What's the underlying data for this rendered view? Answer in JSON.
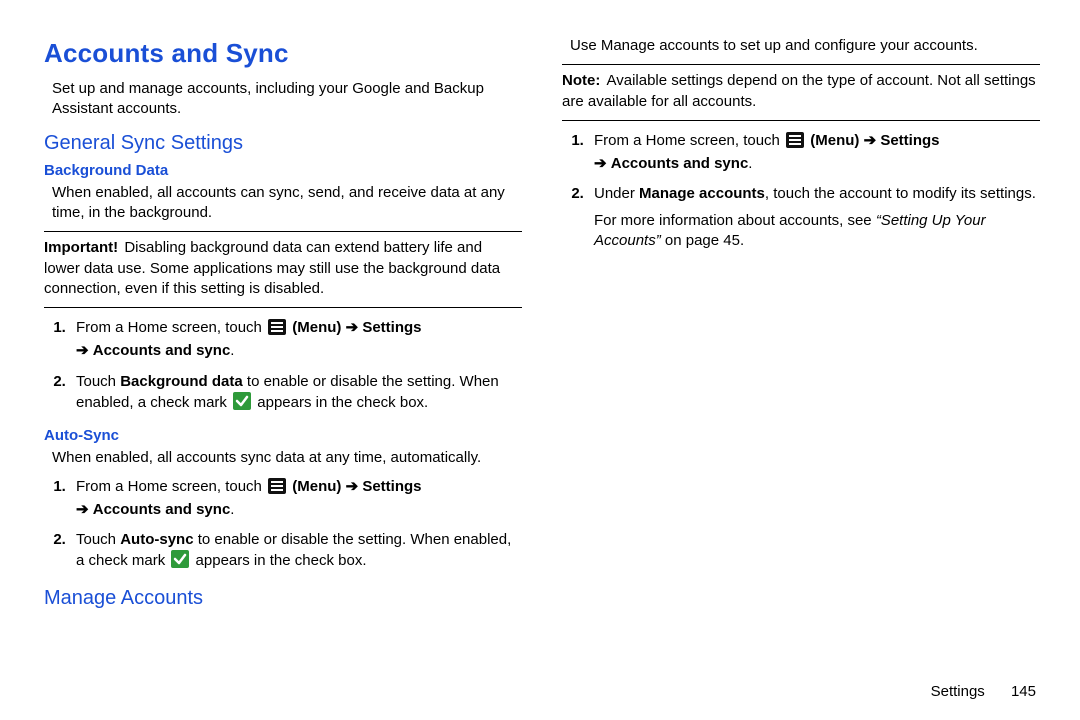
{
  "title": "Accounts and Sync",
  "intro": "Set up and manage accounts, including your Google and Backup Assistant accounts.",
  "general": {
    "heading": "General Sync Settings",
    "bg": {
      "heading": "Background Data",
      "desc": "When enabled, all accounts can sync, send, and receive data at any time, in the background.",
      "important_lead": "Important!",
      "important_body": "Disabling background data can extend battery life and lower data use. Some applications may still use the background data connection, even if this setting is disabled.",
      "step1_pre": "From a Home screen, touch ",
      "menu_label": "(Menu)",
      "arrow": "➔",
      "settings_label": "Settings",
      "acct_sync_label": "Accounts and sync",
      "period": ".",
      "step2a": "Touch ",
      "step2_bold": "Background data",
      "step2b": " to enable or disable the setting. When enabled, a check mark ",
      "step2c": " appears in the check box."
    },
    "auto": {
      "heading": "Auto-Sync",
      "desc": "When enabled, all accounts sync data at any time, automatically.",
      "step2a": "Touch ",
      "step2_bold": "Auto-sync",
      "step2b": " to enable or disable the setting. When enabled, a check mark ",
      "step2c": " appears in the check box."
    }
  },
  "manage": {
    "heading": "Manage Accounts",
    "desc": "Use Manage accounts to set up and configure your accounts.",
    "note_lead": "Note:",
    "note_body": "Available settings depend on the type of account. Not all settings are available for all accounts.",
    "step2a": "Under ",
    "step2_bold": "Manage accounts",
    "step2b": ", touch the account to modify its settings.",
    "more_a": "For more information about accounts, see ",
    "more_ref": "“Setting Up Your Accounts”",
    "more_b": " on page 45."
  },
  "footer": {
    "section": "Settings",
    "page": "145"
  },
  "icons": {
    "menu": "menu-icon",
    "check": "check-icon"
  }
}
